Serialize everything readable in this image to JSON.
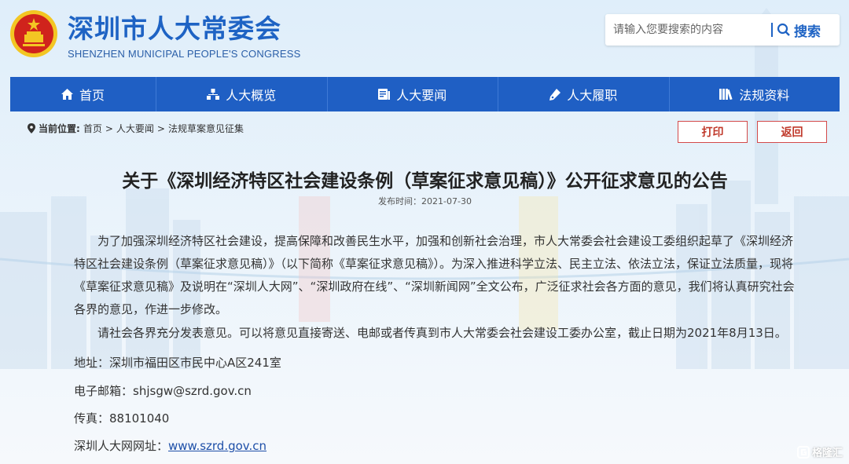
{
  "header": {
    "site_title": "深圳市人大常委会",
    "site_subtitle": "SHENZHEN MUNICIPAL PEOPLE'S CONGRESS",
    "search": {
      "placeholder": "请输入您要搜索的内容",
      "button_label": "搜索"
    }
  },
  "nav": {
    "items": [
      {
        "label": "首页",
        "icon": "home-icon"
      },
      {
        "label": "人大概览",
        "icon": "org-chart-icon"
      },
      {
        "label": "人大要闻",
        "icon": "news-icon"
      },
      {
        "label": "人大履职",
        "icon": "pen-icon"
      },
      {
        "label": "法规资料",
        "icon": "books-icon"
      }
    ]
  },
  "breadcrumb": {
    "label": "当前位置:",
    "items": [
      "首页",
      "人大要闻",
      "法规草案意见征集"
    ]
  },
  "actions": {
    "print_label": "打印",
    "back_label": "返回"
  },
  "article": {
    "title": "关于《深圳经济特区社会建设条例（草案征求意见稿）》公开征求意见的公告",
    "published": "发布时间：2021-07-30",
    "paragraph1": "为了加强深圳经济特区社会建设，提高保障和改善民生水平，加强和创新社会治理，市人大常委会社会建设工委组织起草了《深圳经济特区社会建设条例（草案征求意见稿）》（以下简称《草案征求意见稿》）。为深入推进科学立法、民主立法、依法立法，保证立法质量，现将《草案征求意见稿》及说明在“深圳人大网”、“深圳政府在线”、“深圳新闻网”全文公布，广泛征求社会各方面的意见，我们将认真研究社会各界的意见，作进一步修改。",
    "paragraph2": "请社会各界充分发表意见。可以将意见直接寄送、电邮或者传真到市人大常委会社会建设工委办公室，截止日期为2021年8月13日。",
    "address": "地址：深圳市福田区市民中心A区241室",
    "email_label": "电子邮箱：",
    "email": "shjsgw@szrd.gov.cn",
    "fax": "传真：88101040",
    "website_label": "深圳人大网网址：",
    "website": "www.szrd.gov.cn"
  },
  "watermark": "格隆汇",
  "colors": {
    "brand_blue": "#1f5fc4",
    "title_blue": "#1e63c4",
    "button_red": "#c0392b",
    "emblem_red": "#d0231c",
    "emblem_gold": "#f3c623"
  }
}
